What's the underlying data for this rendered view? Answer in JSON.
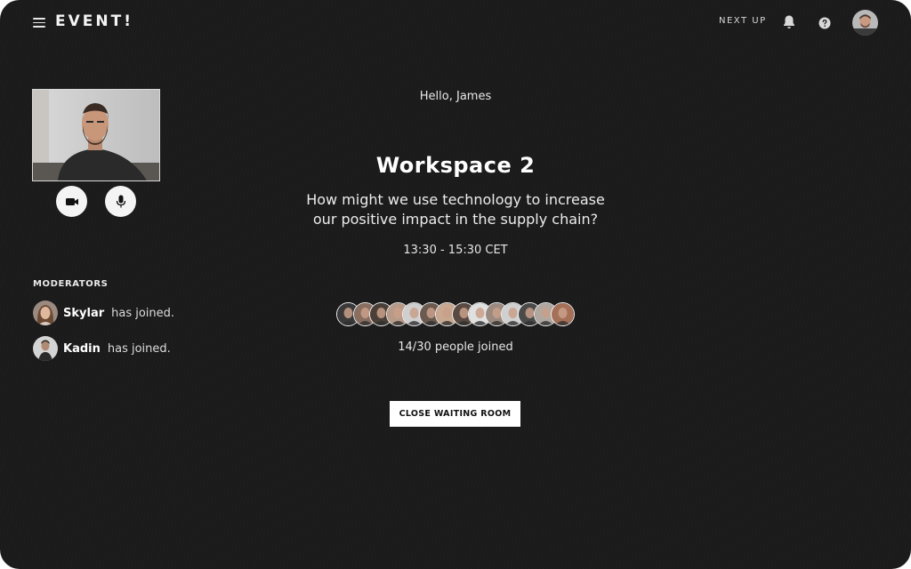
{
  "header": {
    "logo": "EVENT!",
    "next_up": "NEXT UP",
    "icons": [
      "menu-icon",
      "bell-icon",
      "help-icon",
      "user-avatar"
    ]
  },
  "greeting": "Hello, James",
  "workspace": {
    "title": "Workspace 2",
    "question": "How might we use technology to increase our positive impact in the supply chain?",
    "time": "13:30 - 15:30 CET"
  },
  "moderators": {
    "title": "MODERATORS",
    "items": [
      {
        "name": "Skylar",
        "status": "has joined."
      },
      {
        "name": "Kadin",
        "status": "has joined."
      }
    ]
  },
  "participants": {
    "joined_text": "14/30 people joined",
    "joined_count": 14,
    "capacity": 30,
    "avatar_tones": [
      "#3a3a3a",
      "#8a6f60",
      "#4a4038",
      "#b89a88",
      "#cfcfcf",
      "#6b5a50",
      "#c8a890",
      "#5a4a42",
      "#e0e0e0",
      "#9a8a80",
      "#d0d0d0",
      "#4a4a4a",
      "#b0a8a0",
      "#a67058"
    ]
  },
  "actions": {
    "close_waiting_room": "CLOSE WAITING ROOM"
  },
  "colors": {
    "background": "#1b1b1c",
    "text": "#f2f2f2",
    "button_bg": "#ffffff"
  }
}
